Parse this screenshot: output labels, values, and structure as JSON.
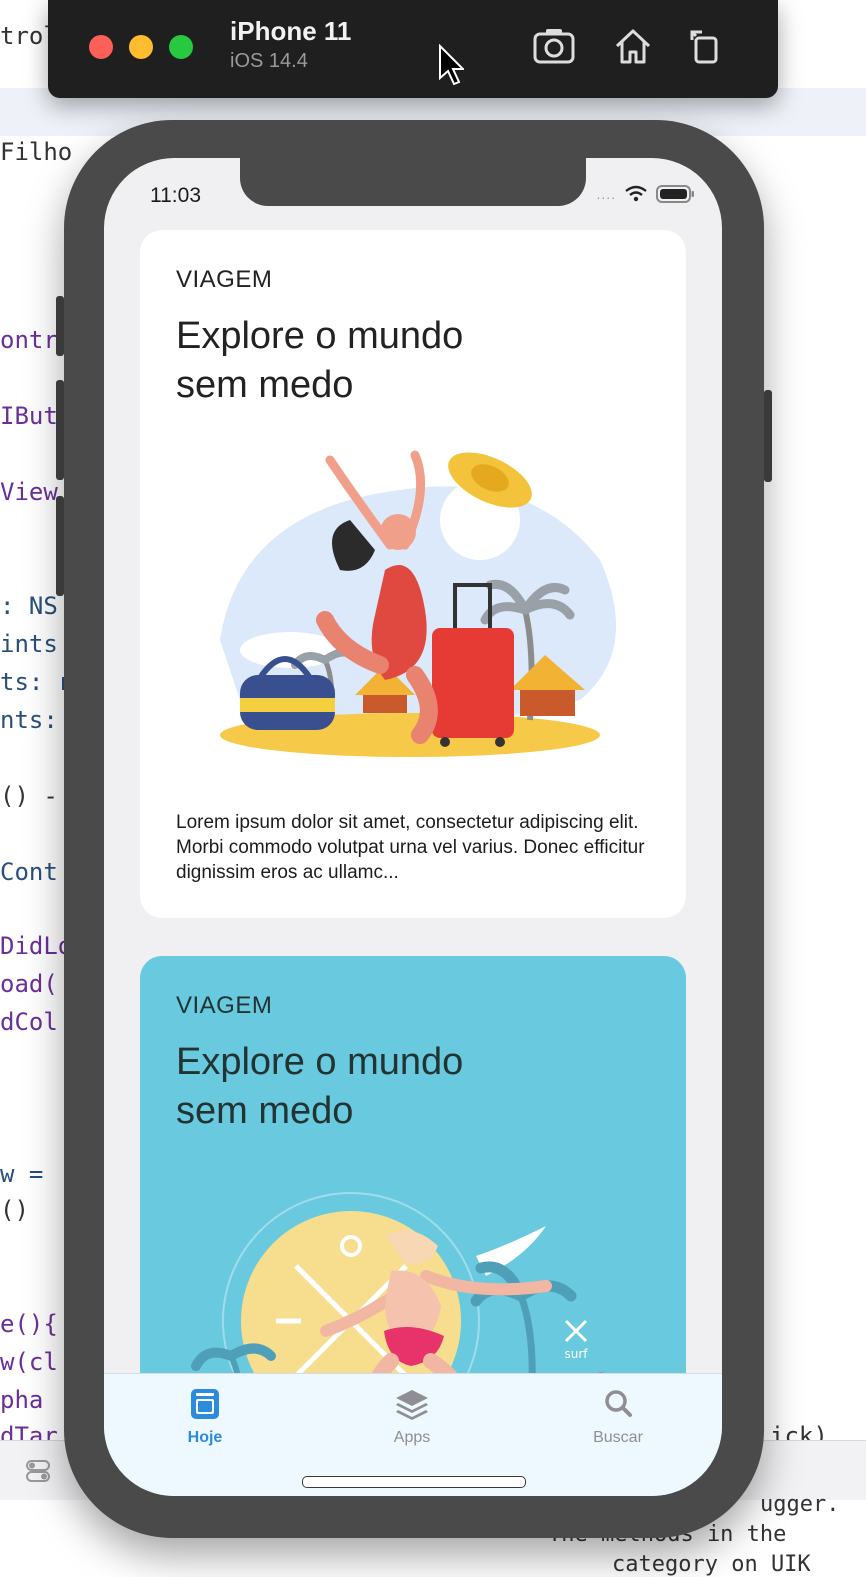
{
  "background_code": {
    "lines": [
      "trol",
      "Filho",
      "ontr",
      "IBut",
      "View",
      ": NS",
      "ints",
      "ts: r",
      "nts:",
      "() -",
      "Cont",
      "DidLo",
      "oad(",
      "dCol",
      "w = ",
      "()",
      "e(){",
      "w(cl",
      "pha ",
      "dTar"
    ],
    "right_fragment": "ick)",
    "console_lines": [
      "ugger.",
      "The methods in the",
      "category on UIK"
    ]
  },
  "simulator": {
    "device_name": "iPhone 11",
    "os_version": "iOS 14.4",
    "toolbar_icons": [
      "screenshot-icon",
      "home-icon",
      "rotate-icon"
    ]
  },
  "status_bar": {
    "time": "11:03",
    "signal": "....",
    "wifi_icon": "wifi-icon",
    "battery_icon": "battery-icon"
  },
  "cards": [
    {
      "category": "VIAGEM",
      "title": "Explore o mundo sem medo",
      "description": "Lorem ipsum dolor sit amet, consectetur adipiscing elit. Morbi commodo volutpat urna vel varius. Donec efficitur dignissim eros ac ullamc...",
      "illustration": "travel-woman-illustration",
      "background": "#ffffff"
    },
    {
      "category": "VIAGEM",
      "title": "Explore o mundo sem medo",
      "illustration": "surfer-illustration",
      "illustration_text": "surf",
      "background": "#69c9de"
    }
  ],
  "tabs": [
    {
      "label": "Hoje",
      "icon": "today-icon",
      "active": true
    },
    {
      "label": "Apps",
      "icon": "apps-stack-icon",
      "active": false
    },
    {
      "label": "Buscar",
      "icon": "search-icon",
      "active": false
    }
  ],
  "colors": {
    "accent": "#2c8bdc",
    "inactive": "#8e8e93",
    "card2_bg": "#69c9de"
  }
}
